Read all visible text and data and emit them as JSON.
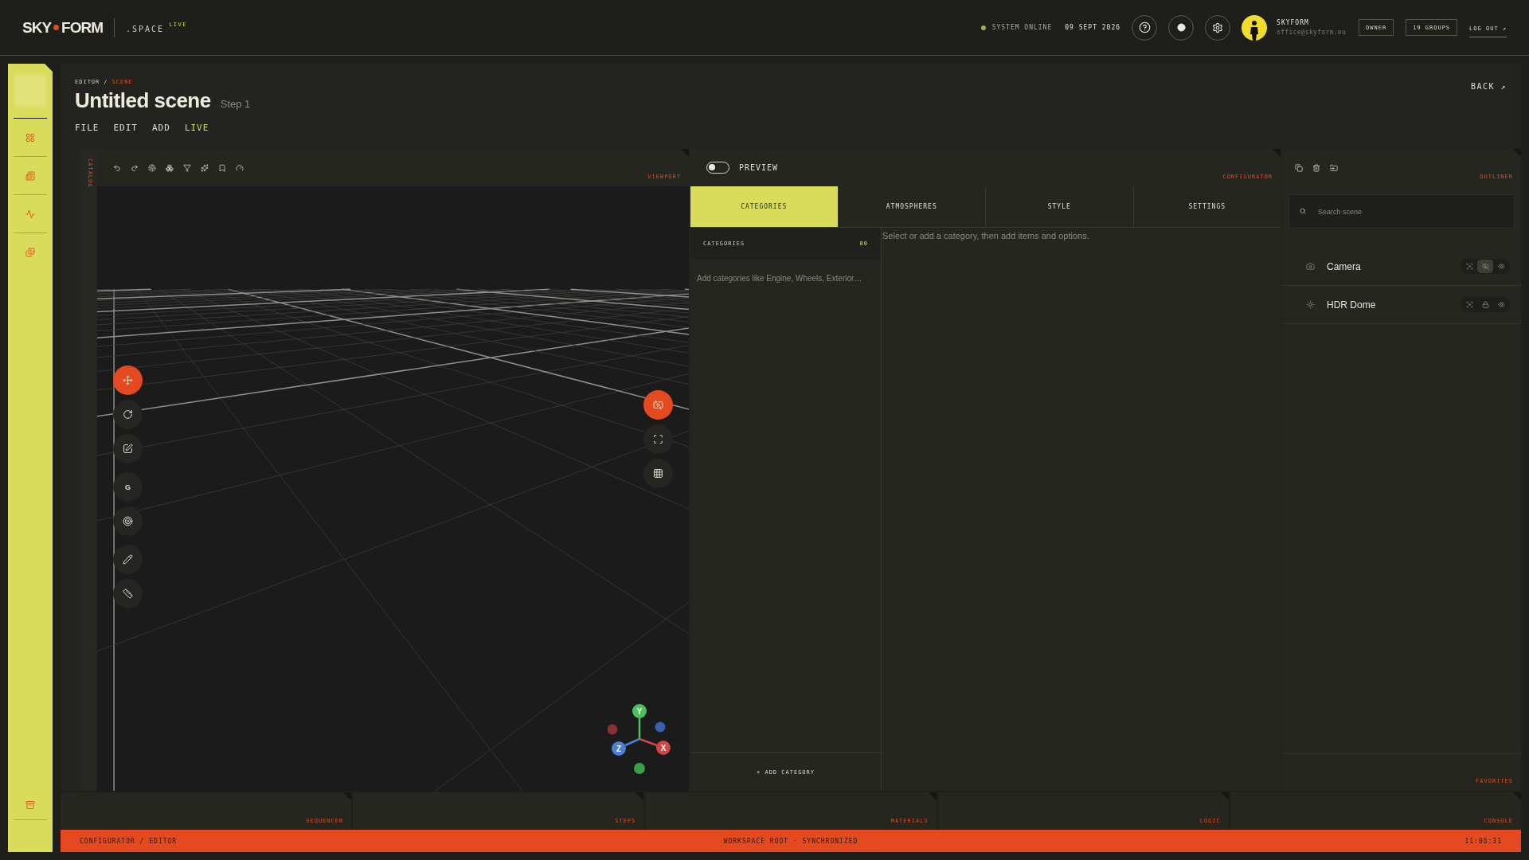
{
  "top_bar": {
    "logo": {
      "left": "SKY",
      "right": "FORM"
    },
    "space": ".SPACE",
    "space_badge": "LIVE",
    "status": {
      "label": "SYSTEM ONLINE",
      "online": true
    },
    "date": "09 SEPT 2026",
    "user": {
      "name": "SKYFORM",
      "email": "office@skyform.eu"
    },
    "role": "OWNER",
    "groups": "19 GROUPS",
    "logout": "LOG OUT ↗"
  },
  "header": {
    "breadcrumb_separator": "/",
    "breadcrumb": [
      {
        "label": "EDITOR",
        "selected": false
      },
      {
        "label": "SCENE",
        "selected": true
      }
    ],
    "title": "Untitled scene",
    "step": "Step 1",
    "back": "BACK ↗",
    "menu": [
      {
        "label": "FILE",
        "highlighted": false
      },
      {
        "label": "EDIT",
        "highlighted": false
      },
      {
        "label": "ADD",
        "highlighted": false
      },
      {
        "label": "LIVE",
        "highlighted": true
      }
    ]
  },
  "catalog": {
    "label": "CATALOG"
  },
  "viewport": {
    "label": "VIEWPORT",
    "tools": [
      {
        "kind": "move",
        "selected": true
      },
      {
        "kind": "rotate",
        "selected": false
      },
      {
        "kind": "scale",
        "selected": false
      },
      {
        "kind": "letter",
        "label": "G",
        "selected": false
      },
      {
        "kind": "target",
        "selected": false
      },
      {
        "kind": "pen",
        "selected": false
      },
      {
        "kind": "ruler",
        "selected": false
      }
    ],
    "view_tools": [
      {
        "kind": "camera",
        "selected": true
      },
      {
        "kind": "fullscreen",
        "selected": false
      },
      {
        "kind": "grid",
        "selected": false
      }
    ],
    "gizmo": {
      "x": "X",
      "y": "Y",
      "z": "Z"
    }
  },
  "configurator": {
    "label": "CONFIGURATOR",
    "preview": {
      "label": "PREVIEW",
      "on": false
    },
    "tabs": [
      {
        "label": "CATEGORIES",
        "selected": true
      },
      {
        "label": "ATMOSPHERES",
        "selected": false
      },
      {
        "label": "STYLE",
        "selected": false
      },
      {
        "label": "SETTINGS",
        "selected": false
      }
    ],
    "categories": {
      "title": "CATEGORIES",
      "count": "00",
      "empty_text": "Add categories like Engine, Wheels, Exterior…",
      "add": "+ ADD CATEGORY"
    },
    "hint": "Select or add a category, then add items and options."
  },
  "outliner": {
    "label": "OUTLINER",
    "search": {
      "placeholder": "Search scene"
    },
    "items": [
      {
        "kind": "camera",
        "name": "Camera",
        "locked": true
      },
      {
        "kind": "light",
        "name": "HDR Dome",
        "locked": false
      }
    ],
    "favorites": "FAVORITES"
  },
  "bottom_panels": [
    {
      "label": "SEQUENCER"
    },
    {
      "label": "STEPS"
    },
    {
      "label": "MATERIALS"
    },
    {
      "label": "LOGIC"
    },
    {
      "label": "CONSOLE"
    }
  ],
  "status_bar": {
    "left": "CONFIGURATOR / EDITOR",
    "center": "WORKSPACE ROOT · SYNCHRONIZED",
    "right": "11:06:31"
  }
}
